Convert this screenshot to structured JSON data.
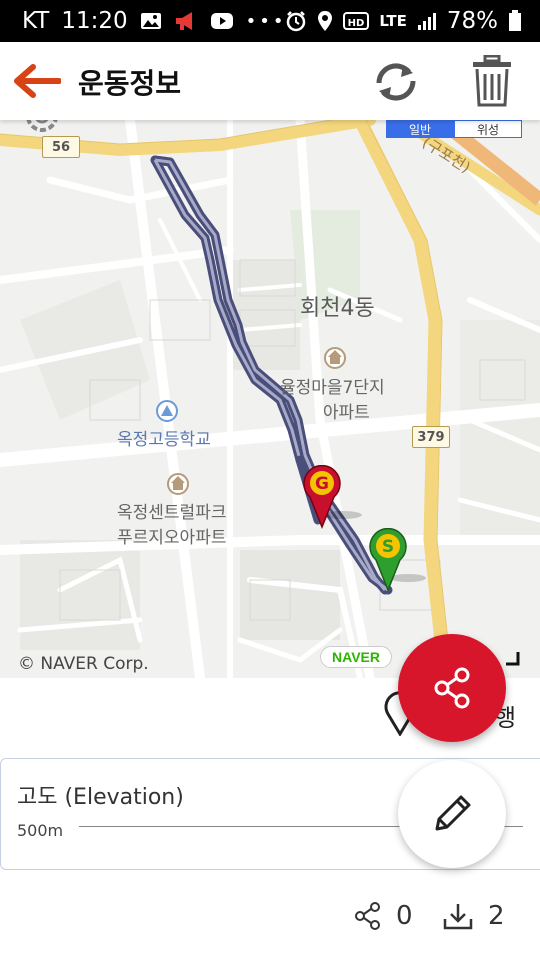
{
  "status_bar": {
    "carrier": "KT",
    "time": "11:20",
    "network": "LTE",
    "battery": "78%"
  },
  "app_bar": {
    "title": "운동정보"
  },
  "map": {
    "map_type_active": "일반",
    "map_type_other": "위성",
    "road_badges": [
      "56",
      "379"
    ],
    "area_label": "회천4동",
    "places": {
      "apartment1_line1": "율정마을7단지",
      "apartment1_line2": "아파트",
      "school": "옥정고등학교",
      "apartment2_line1": "옥정센트럴파크",
      "apartment2_line2": "푸르지오아파트",
      "road_partial": "(구포천)"
    },
    "copyright": "© NAVER Corp.",
    "logo": "NAVER",
    "markers": {
      "goal": "G",
      "start": "S"
    },
    "route_color": "#4a4e7a"
  },
  "lower": {
    "partial_label": "행"
  },
  "elevation": {
    "title": "고도 (Elevation)",
    "tick": "500m"
  },
  "stats": {
    "share_count": "0",
    "download_count": "2"
  },
  "colors": {
    "accent_red": "#d8162b",
    "back_arrow": "#d84315",
    "map_blue": "#3a6ee8"
  },
  "icons": {
    "back": "arrow-left-icon",
    "refresh": "refresh-icon",
    "delete": "trash-icon",
    "share": "share-icon",
    "edit": "pencil-icon",
    "download": "download-icon"
  }
}
